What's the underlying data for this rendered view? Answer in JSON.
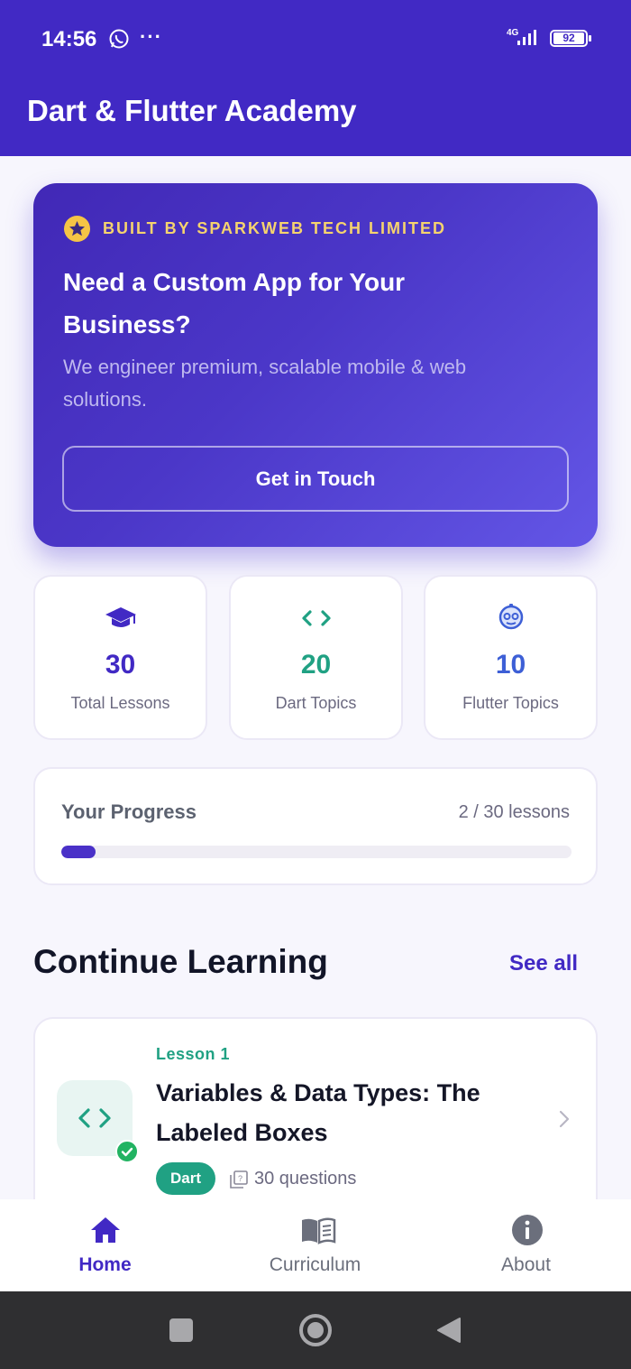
{
  "status_bar": {
    "time": "14:56",
    "network": "4G",
    "battery": "92"
  },
  "app_bar": {
    "title": "Dart & Flutter Academy"
  },
  "promo": {
    "eyebrow": "BUILT BY SPARKWEB TECH LIMITED",
    "title": "Need a Custom App for Your Business?",
    "description": "We engineer premium, scalable mobile & web solutions.",
    "button": "Get in Touch"
  },
  "stats": [
    {
      "value": "30",
      "label": "Total Lessons",
      "icon": "graduation-cap-icon",
      "color": "#4129c4"
    },
    {
      "value": "20",
      "label": "Dart Topics",
      "icon": "code-icon",
      "color": "#20a183"
    },
    {
      "value": "10",
      "label": "Flutter Topics",
      "icon": "robot-icon",
      "color": "#3d5fd6"
    }
  ],
  "progress": {
    "title": "Your Progress",
    "count_text": "2 / 30 lessons",
    "completed": 2,
    "total": 30
  },
  "continue": {
    "title": "Continue Learning",
    "see_all": "See all",
    "lesson": {
      "number": "Lesson 1",
      "title": "Variables & Data Types: The Labeled Boxes",
      "tag": "Dart",
      "questions": "30 questions",
      "completed": true
    }
  },
  "bottom_nav": [
    {
      "label": "Home",
      "icon": "home-icon",
      "active": true
    },
    {
      "label": "Curriculum",
      "icon": "book-icon",
      "active": false
    },
    {
      "label": "About",
      "icon": "info-icon",
      "active": false
    }
  ],
  "colors": {
    "primary": "#4129c4",
    "accent": "#20a183",
    "star": "#f5c445"
  }
}
